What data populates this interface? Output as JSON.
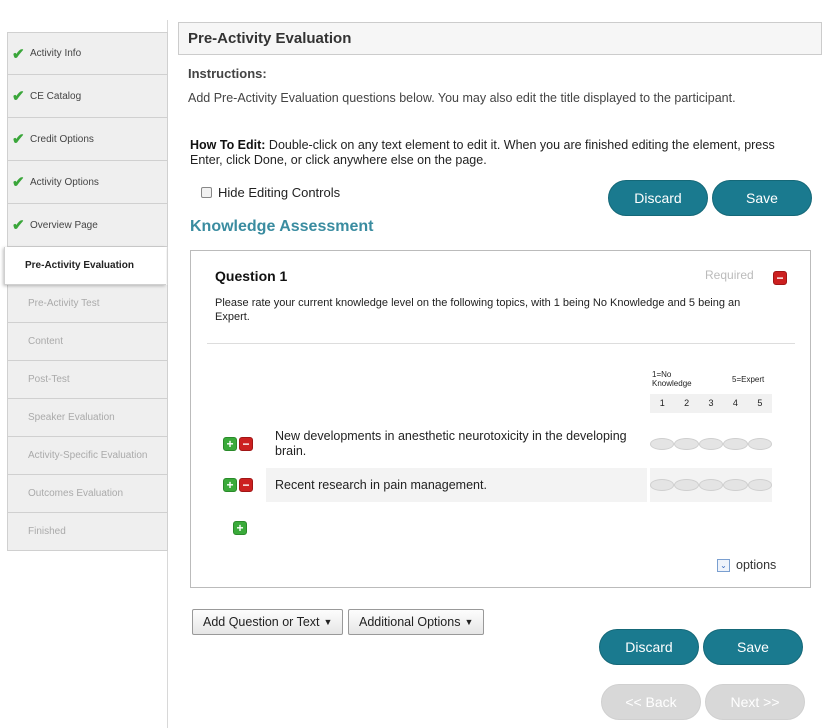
{
  "sidebar": {
    "items": [
      {
        "label": "Activity Info"
      },
      {
        "label": "CE Catalog"
      },
      {
        "label": "Credit Options"
      },
      {
        "label": "Activity Options"
      },
      {
        "label": "Overview Page"
      },
      {
        "label": "Pre-Activity Evaluation"
      },
      {
        "label": "Pre-Activity Test"
      },
      {
        "label": "Content"
      },
      {
        "label": "Post-Test"
      },
      {
        "label": "Speaker Evaluation"
      },
      {
        "label": "Activity-Specific Evaluation"
      },
      {
        "label": "Outcomes Evaluation"
      },
      {
        "label": "Finished"
      }
    ],
    "check_glyph": "✔"
  },
  "header": {
    "title": "Pre-Activity Evaluation"
  },
  "instructions": {
    "label": "Instructions:",
    "text": "Add Pre-Activity Evaluation questions below. You may also edit the title displayed to the participant."
  },
  "howto": {
    "label": "How To Edit:",
    "text": " Double-click on any text element to edit it. When you are finished editing the element, press Enter, click Done, or click anywhere else on the page."
  },
  "hide_controls": {
    "label": "Hide Editing Controls",
    "checked": false
  },
  "buttons": {
    "discard": "Discard",
    "save": "Save",
    "back": "<< Back",
    "next": "Next >>"
  },
  "section_title": "Knowledge Assessment",
  "question": {
    "title": "Question 1",
    "required": "Required",
    "description": "Please rate your current knowledge level on the following topics, with 1 being No Knowledge and 5 being an Expert.",
    "scale_low": [
      "1=No",
      "Knowledge"
    ],
    "scale_high": "5=Expert",
    "scale": [
      "1",
      "2",
      "3",
      "4",
      "5"
    ],
    "rows": [
      {
        "text": "New developments in anesthetic neurotoxicity in the developing brain."
      },
      {
        "text": "Recent research in pain management."
      }
    ],
    "options_label": "options"
  },
  "toolbar": {
    "add_question": "Add Question or Text",
    "additional_options": "Additional Options"
  },
  "icons": {
    "plus": "+",
    "minus": "−",
    "caret": "▼",
    "chevron": "⌄"
  },
  "colors": {
    "accent": "#1a7a8f",
    "check": "#3aa63a",
    "section_title": "#3a8ca0"
  }
}
